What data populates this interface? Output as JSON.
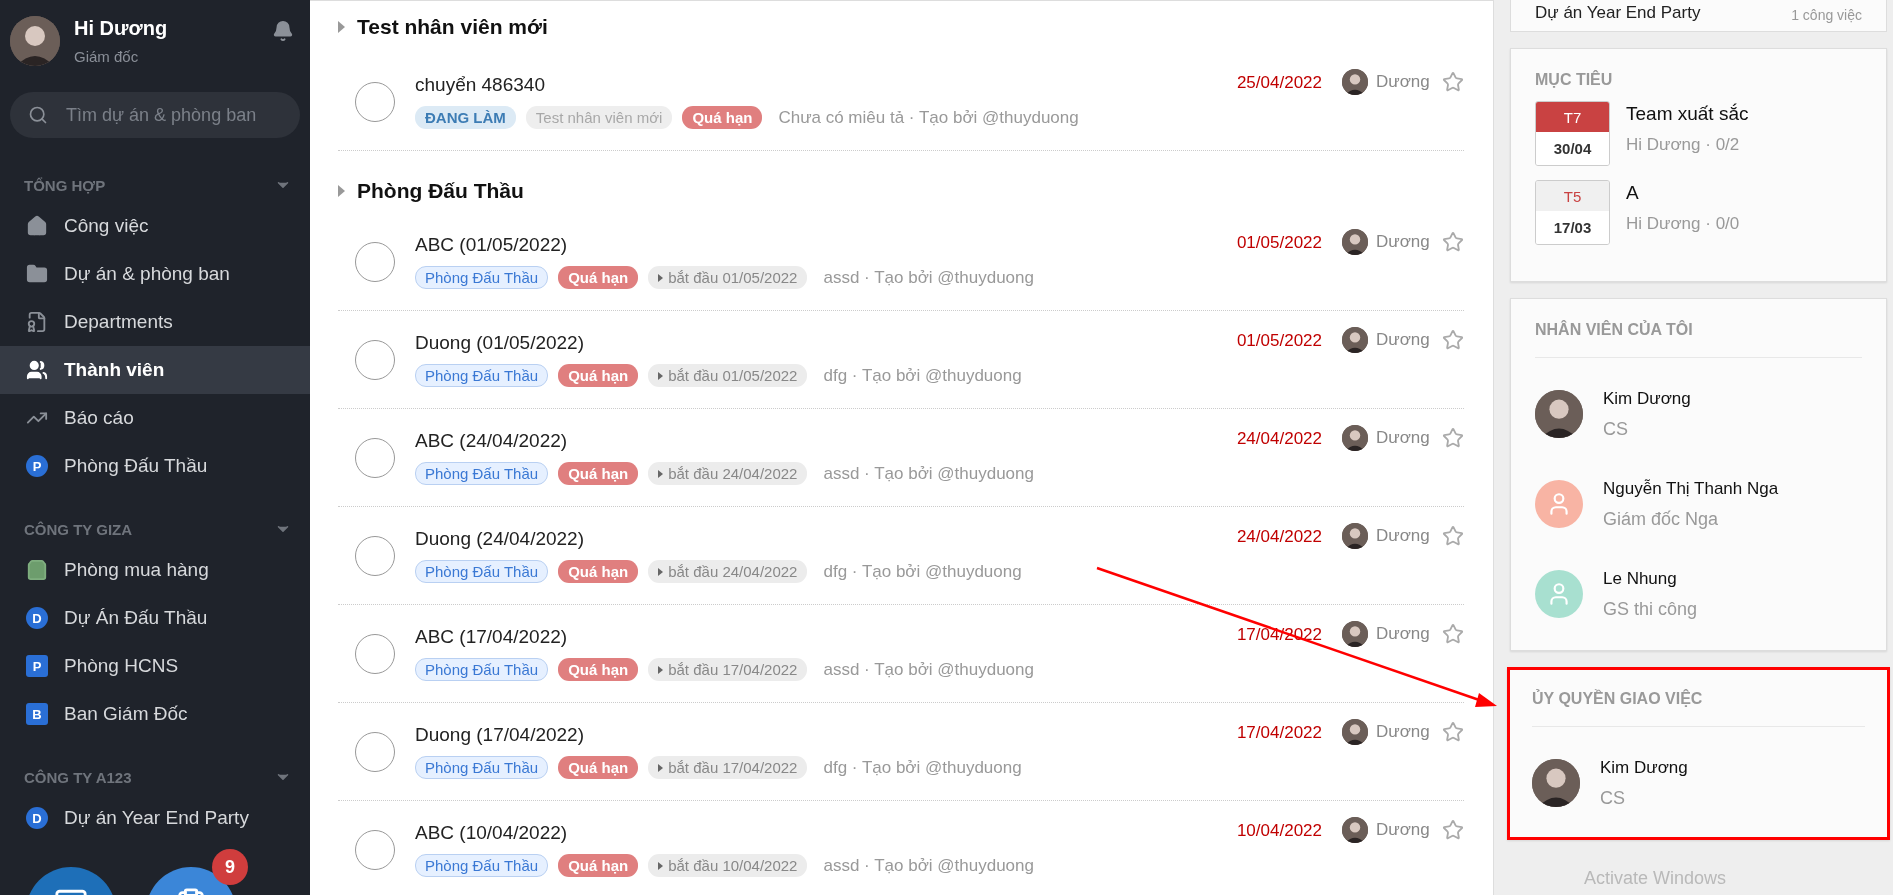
{
  "sidebar": {
    "user": {
      "name": "Hi Dương",
      "role": "Giám đốc"
    },
    "search": {
      "placeholder": "Tìm dự án & phòng ban"
    },
    "groups": [
      {
        "title": "TỔNG HỢP",
        "items": [
          {
            "label": "Công việc",
            "kind": "home",
            "selected": false
          },
          {
            "label": "Dự án & phòng ban",
            "kind": "folder",
            "selected": false
          },
          {
            "label": "Departments",
            "kind": "departments",
            "selected": false
          },
          {
            "label": "Thành viên",
            "kind": "members",
            "selected": true
          },
          {
            "label": "Báo cáo",
            "kind": "report",
            "selected": false
          },
          {
            "label": "Phòng Đấu Thầu",
            "kind": "letter-circle",
            "letter": "P",
            "selected": false
          }
        ]
      },
      {
        "title": "CÔNG TY GIZA",
        "items": [
          {
            "label": "Phòng mua hàng",
            "kind": "bag",
            "selected": false
          },
          {
            "label": "Dự Án Đấu Thầu",
            "kind": "letter-circle",
            "letter": "D",
            "selected": false
          },
          {
            "label": "Phòng HCNS",
            "kind": "letter-square",
            "letter": "P",
            "selected": false
          },
          {
            "label": "Ban Giám Đốc",
            "kind": "letter-square",
            "letter": "B",
            "selected": false
          }
        ]
      },
      {
        "title": "CÔNG TY A123",
        "items": [
          {
            "label": "Dự án Year End Party",
            "kind": "letter-circle",
            "letter": "D",
            "selected": false
          }
        ]
      }
    ],
    "task_badge": "9"
  },
  "main": {
    "sections": [
      {
        "title": "Test nhân viên mới",
        "tasks": [
          {
            "title": "chuyển 486340",
            "done": false,
            "tags": [
              {
                "label": "ĐANG LÀM",
                "kind": "status"
              },
              {
                "label": "Test nhân viên mới",
                "kind": "project-grey"
              },
              {
                "label": "Quá hạn",
                "kind": "overdue"
              }
            ],
            "note": "Chưa có miêu tả · Tạo bởi @thuyduong",
            "due": "25/04/2022",
            "assignee": "Dương",
            "starred": false
          }
        ]
      },
      {
        "title": "Phòng Đấu Thầu",
        "tasks": [
          {
            "title": "ABC (01/05/2022)",
            "done": false,
            "tags": [
              {
                "label": "Phòng Đấu Thầu",
                "kind": "project"
              },
              {
                "label": "Quá hạn",
                "kind": "overdue"
              },
              {
                "label": "bắt đầu 01/05/2022",
                "kind": "start"
              }
            ],
            "note": "assd · Tạo bởi @thuyduong",
            "due": "01/05/2022",
            "assignee": "Dương",
            "starred": false
          },
          {
            "title": "Duong (01/05/2022)",
            "done": false,
            "tags": [
              {
                "label": "Phòng Đấu Thầu",
                "kind": "project"
              },
              {
                "label": "Quá hạn",
                "kind": "overdue"
              },
              {
                "label": "bắt đầu 01/05/2022",
                "kind": "start"
              }
            ],
            "note": "dfg · Tạo bởi @thuyduong",
            "due": "01/05/2022",
            "assignee": "Dương",
            "starred": false
          },
          {
            "title": "ABC (24/04/2022)",
            "done": false,
            "tags": [
              {
                "label": "Phòng Đấu Thầu",
                "kind": "project"
              },
              {
                "label": "Quá hạn",
                "kind": "overdue"
              },
              {
                "label": "bắt đầu 24/04/2022",
                "kind": "start"
              }
            ],
            "note": "assd · Tạo bởi @thuyduong",
            "due": "24/04/2022",
            "assignee": "Dương",
            "starred": false
          },
          {
            "title": "Duong (24/04/2022)",
            "done": false,
            "tags": [
              {
                "label": "Phòng Đấu Thầu",
                "kind": "project"
              },
              {
                "label": "Quá hạn",
                "kind": "overdue"
              },
              {
                "label": "bắt đầu 24/04/2022",
                "kind": "start"
              }
            ],
            "note": "dfg · Tạo bởi @thuyduong",
            "due": "24/04/2022",
            "assignee": "Dương",
            "starred": false
          },
          {
            "title": "ABC (17/04/2022)",
            "done": false,
            "tags": [
              {
                "label": "Phòng Đấu Thầu",
                "kind": "project"
              },
              {
                "label": "Quá hạn",
                "kind": "overdue"
              },
              {
                "label": "bắt đầu 17/04/2022",
                "kind": "start"
              }
            ],
            "note": "assd · Tạo bởi @thuyduong",
            "due": "17/04/2022",
            "assignee": "Dương",
            "starred": false
          },
          {
            "title": "Duong (17/04/2022)",
            "done": false,
            "tags": [
              {
                "label": "Phòng Đấu Thầu",
                "kind": "project"
              },
              {
                "label": "Quá hạn",
                "kind": "overdue"
              },
              {
                "label": "bắt đầu 17/04/2022",
                "kind": "start"
              }
            ],
            "note": "dfg · Tạo bởi @thuyduong",
            "due": "17/04/2022",
            "assignee": "Dương",
            "starred": false
          },
          {
            "title": "ABC (10/04/2022)",
            "done": false,
            "tags": [
              {
                "label": "Phòng Đấu Thầu",
                "kind": "project"
              },
              {
                "label": "Quá hạn",
                "kind": "overdue"
              },
              {
                "label": "bắt đầu 10/04/2022",
                "kind": "start"
              }
            ],
            "note": "assd · Tạo bởi @thuyduong",
            "due": "10/04/2022",
            "assignee": "Dương",
            "starred": false
          }
        ]
      }
    ]
  },
  "right": {
    "project": {
      "title": "Dự án Year End Party",
      "count": "1 công việc"
    },
    "goals": {
      "heading": "MỤC TIÊU",
      "items": [
        {
          "weekday": "T7",
          "date": "30/04",
          "title": "Team xuất sắc",
          "owner": "Hi Dương",
          "separator": "·",
          "progress": "0/2",
          "current": true
        },
        {
          "weekday": "T5",
          "date": "17/03",
          "title": "A",
          "owner": "Hi Dương",
          "separator": "·",
          "progress": "0/0",
          "current": false
        }
      ]
    },
    "cards": [
      {
        "heading": "NHÂN VIÊN CỦA TÔI",
        "highlighted": false,
        "people": [
          {
            "name": "Kim Dương",
            "role": "CS",
            "kind": "photo"
          },
          {
            "name": "Nguyễn Thị Thanh Nga",
            "role": "Giám đốc Nga",
            "kind": "placeholder",
            "color": "#f8b4a4"
          },
          {
            "name": "Le Nhung",
            "role": "GS thi công",
            "kind": "placeholder",
            "color": "#a8e0d0"
          }
        ]
      },
      {
        "heading": "ỦY QUYỀN GIAO VIỆC",
        "highlighted": true,
        "people": [
          {
            "name": "Kim Dương",
            "role": "CS",
            "kind": "photo"
          }
        ]
      }
    ],
    "notice": "Activate Windows"
  }
}
